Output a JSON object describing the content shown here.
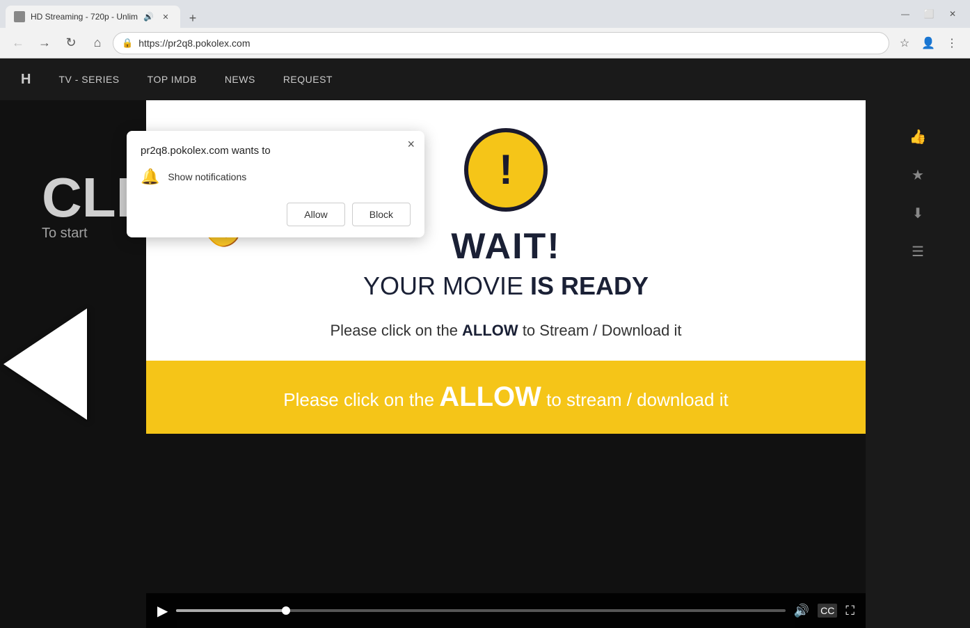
{
  "browser": {
    "tab_title": "HD Streaming - 720p - Unlim",
    "url": "https://pr2q8.pokolex.com",
    "new_tab_label": "+",
    "window_controls": {
      "minimize": "—",
      "maximize": "⬜",
      "close": "✕"
    }
  },
  "nav": {
    "back_title": "Back",
    "forward_title": "Forward",
    "reload_title": "Reload",
    "home_title": "Home",
    "bookmark_title": "Bookmark",
    "profile_title": "Profile",
    "more_title": "More"
  },
  "site_nav": {
    "logo": "H",
    "items": [
      "TV - SERIES",
      "TOP IMDB",
      "NEWS",
      "REQUEST"
    ]
  },
  "bg_content": {
    "big_text": "CLI",
    "sub_text": "To start"
  },
  "modal": {
    "warning_icon": "!",
    "wait_text": "WAIT!",
    "movie_ready_part1": "YOUR MOVIE ",
    "movie_ready_bold": "IS READY",
    "instruction_part1": "Please click on the ",
    "instruction_allow": "ALLOW",
    "instruction_part2": " to Stream / Download it"
  },
  "yellow_banner": {
    "text_part1": "Please click on the ",
    "text_allow": "ALLOW",
    "text_part2": " to stream / download it"
  },
  "notification_popup": {
    "title": "pr2q8.pokolex.com wants to",
    "close_label": "×",
    "permission_text": "Show notifications",
    "allow_label": "Allow",
    "block_label": "Block"
  },
  "video_controls": {
    "play_icon": "▶",
    "volume_icon": "🔊",
    "cc_label": "CC",
    "expand_icon": "⛶",
    "progress_percent": 18
  }
}
